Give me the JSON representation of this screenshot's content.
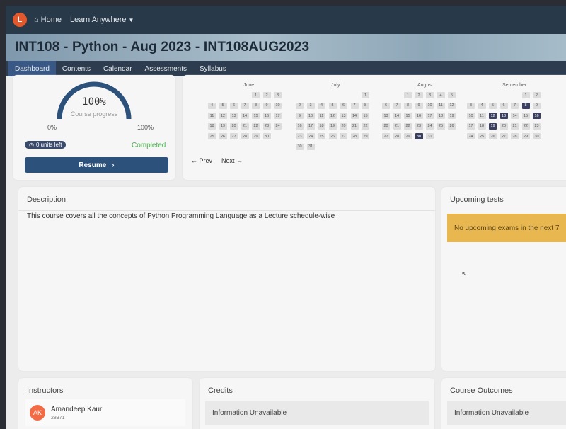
{
  "app": {
    "logo_letter": "L",
    "nav": {
      "home": "Home",
      "learn": "Learn Anywhere"
    }
  },
  "course": {
    "title": "INT108 - Python - Aug 2023 - INT108AUG2023"
  },
  "tabs": [
    "Dashboard",
    "Contents",
    "Calendar",
    "Assessments",
    "Syllabus"
  ],
  "progress": {
    "percent_text": "100%",
    "label": "Course progress",
    "value": 1.0,
    "min_label": "0%",
    "max_label": "100%",
    "units_left": "0 units left",
    "status": "Completed",
    "resume_label": "Resume",
    "accent": "#2c527c"
  },
  "calendar": {
    "prev": "Prev",
    "next": "Next",
    "months": [
      {
        "name": "June",
        "start": 4,
        "days": 30,
        "highlight": []
      },
      {
        "name": "July",
        "start": 6,
        "days": 31,
        "highlight": []
      },
      {
        "name": "August",
        "start": 2,
        "days": 31,
        "highlight": [
          30
        ]
      },
      {
        "name": "September",
        "start": 5,
        "days": 30,
        "highlight": [
          8,
          12,
          13,
          16,
          19
        ]
      }
    ]
  },
  "description": {
    "title": "Description",
    "text": "This course covers all the concepts of Python Programming Language as a Lecture schedule-wise"
  },
  "tests": {
    "title": "Upcoming tests",
    "message": "No upcoming exams in the next 7"
  },
  "instructors": {
    "title": "Instructors",
    "items": [
      {
        "initials": "AK",
        "name": "Amandeep Kaur",
        "id": "28971"
      }
    ]
  },
  "credits": {
    "title": "Credits",
    "value": "Information Unavailable"
  },
  "outcomes": {
    "title": "Course Outcomes",
    "value": "Information Unavailable"
  }
}
